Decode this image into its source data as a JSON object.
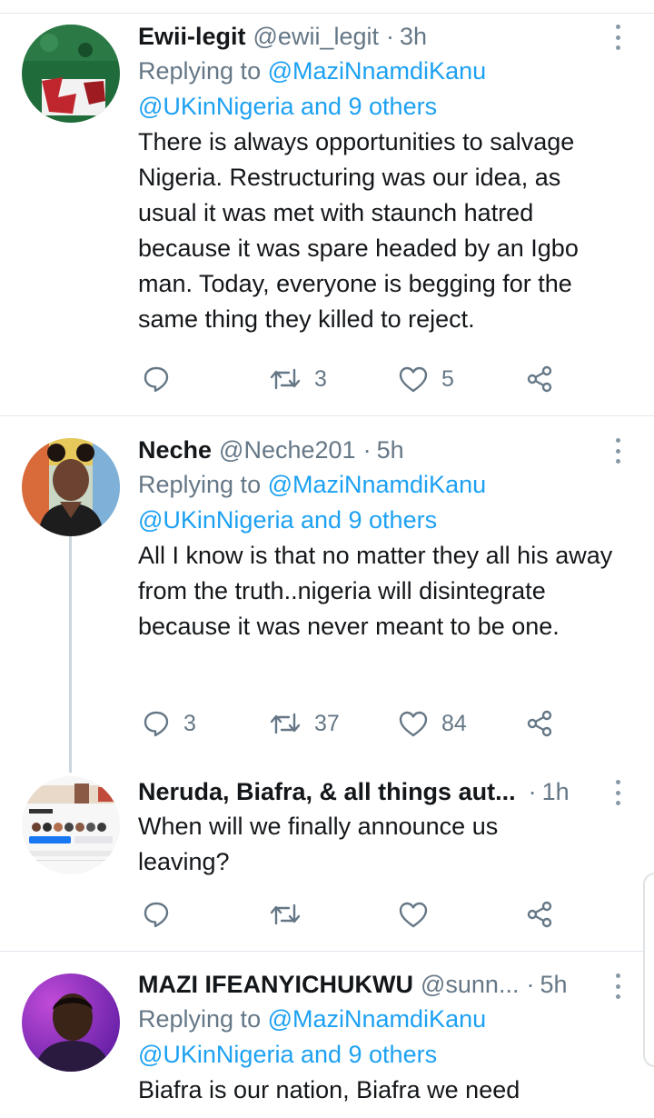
{
  "tweets": [
    {
      "name": "Ewii-legit",
      "handle": "@ewii_legit",
      "time": "3h",
      "replying_prefix": "Replying to",
      "replying_user": "@MaziNnamdiKanu",
      "replying_others": "@UKinNigeria and 9 others",
      "text": "There is always opportunities to salvage Nigeria. Restructuring was our idea, as usual it was met with staunch hatred because it was spare headed by an Igbo man. Today, everyone is begging for the same thing they killed to reject.",
      "replies": "",
      "retweets": "3",
      "likes": "5"
    },
    {
      "name": "Neche",
      "handle": "@Neche201",
      "time": "5h",
      "replying_prefix": "Replying to",
      "replying_user": "@MaziNnamdiKanu",
      "replying_others": "@UKinNigeria and 9 others",
      "text": "All I know is that no matter they all his away from the truth..nigeria will disintegrate because it was never meant to be one.",
      "replies": "3",
      "retweets": "37",
      "likes": "84"
    },
    {
      "name": "Neruda, Biafra, & all things aut...",
      "time": "1h",
      "text": "When will we finally announce us leaving?",
      "replies": "",
      "retweets": "",
      "likes": ""
    },
    {
      "name": "MAZI IFEANYICHUKWU",
      "handle": "@sunn...",
      "time": "5h",
      "replying_prefix": "Replying to",
      "replying_user": "@MaziNnamdiKanu",
      "replying_others": "@UKinNigeria and 9 others",
      "text": "Biafra is our nation, Biafra we need"
    }
  ],
  "colors": {
    "link": "#1da1f2",
    "secondary_text": "#657786",
    "primary_text": "#14171a",
    "divider": "#e1e8ed"
  },
  "icons": {
    "reply": "reply-bubble-icon",
    "retweet": "retweet-icon",
    "like": "heart-icon",
    "share": "share-icon",
    "menu": "more-vertical-icon"
  }
}
